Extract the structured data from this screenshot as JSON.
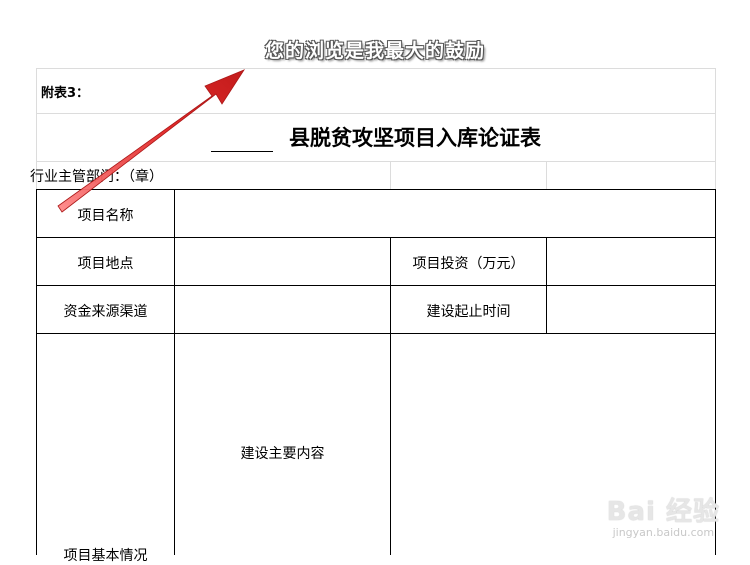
{
  "banner": {
    "text": "您的浏览是我最大的鼓励"
  },
  "form": {
    "attachment_label": "附表3：",
    "title_suffix": "县脱贫攻坚项目入库论证表",
    "dept_label": "行业主管部门：（章）",
    "rows": {
      "project_name": "项目名称",
      "project_location": "项目地点",
      "project_investment": "项目投资（万元）",
      "fund_source": "资金来源渠道",
      "construction_period": "建设起止时间",
      "main_content": "建设主要内容",
      "basic_situation": "项目基本情况"
    }
  },
  "watermark": {
    "logo": "Bai 经验",
    "url": "jingyan.baidu.com"
  },
  "colors": {
    "grid": "#dcdcdc",
    "border": "#000000",
    "arrow": "#e02020"
  }
}
